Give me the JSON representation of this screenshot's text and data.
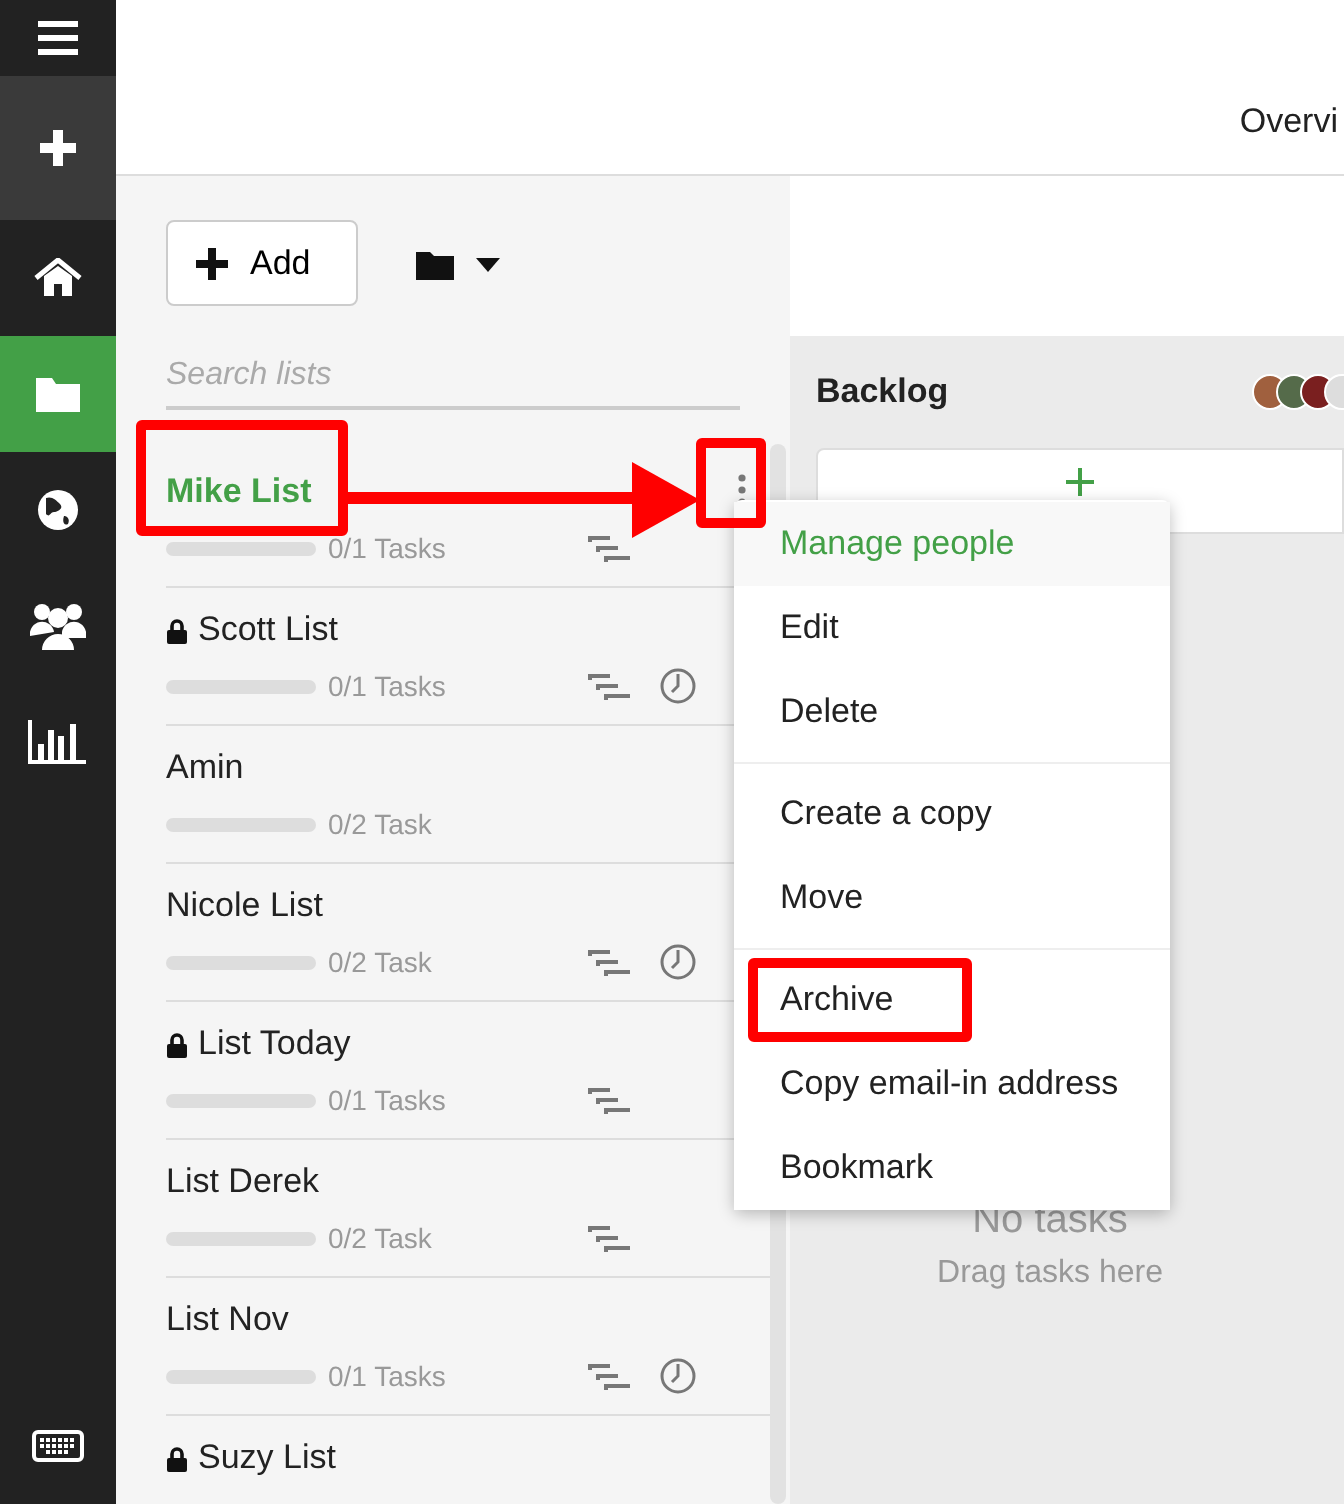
{
  "sidebar": {
    "items": [
      {
        "kind": "menu",
        "selected": false
      },
      {
        "kind": "action",
        "selected": false
      },
      {
        "kind": "home",
        "selected": false
      },
      {
        "kind": "folder",
        "selected": true
      },
      {
        "kind": "globe",
        "selected": false
      },
      {
        "kind": "people",
        "selected": false
      },
      {
        "kind": "chart",
        "selected": false
      },
      {
        "kind": "keyboard",
        "selected": false
      }
    ]
  },
  "header": {
    "tab": "Overvi"
  },
  "toolbar": {
    "add_button": "Add"
  },
  "search": {
    "placeholder": "Search lists"
  },
  "lists": [
    {
      "name": "Mike List",
      "selected": true,
      "locked": false,
      "level": 0,
      "tasks": "0/1 Tasks",
      "subtasks": true,
      "clock": false
    },
    {
      "name": "Scott List",
      "selected": false,
      "locked": true,
      "level": 0,
      "tasks": "0/1 Tasks",
      "subtasks": true,
      "clock": true
    },
    {
      "name": "Amin",
      "selected": false,
      "locked": false,
      "level": 0,
      "tasks": "0/2 Task",
      "subtasks": false,
      "clock": false
    },
    {
      "name": "Nicole List",
      "selected": false,
      "locked": false,
      "level": 0,
      "tasks": "0/2 Task",
      "subtasks": true,
      "clock": true
    },
    {
      "name": "List Today",
      "selected": false,
      "locked": true,
      "level": 0,
      "tasks": "0/1 Tasks",
      "subtasks": true,
      "clock": false
    },
    {
      "name": "List Derek",
      "selected": false,
      "locked": false,
      "level": 0,
      "tasks": "0/2 Task",
      "subtasks": true,
      "clock": false
    },
    {
      "name": "List Nov",
      "selected": false,
      "locked": false,
      "level": 0,
      "tasks": "0/1 Tasks",
      "subtasks": true,
      "clock": true
    },
    {
      "name": "Suzy List",
      "selected": false,
      "locked": true,
      "level": 0,
      "subtasks": false,
      "clock": false
    }
  ],
  "board": {
    "column_title": "Backlog",
    "empty_title": "No tasks",
    "empty_hint": "Drag tasks here"
  },
  "context_menu": {
    "groups": [
      [
        {
          "label": "Manage people",
          "selected": true
        },
        {
          "label": "Edit",
          "selected": false
        },
        {
          "label": "Delete",
          "selected": false
        }
      ],
      [
        {
          "label": "Create a copy",
          "selected": false
        },
        {
          "label": "Move",
          "selected": false
        }
      ],
      [
        {
          "label": "Archive",
          "selected": false,
          "annotated": true
        },
        {
          "label": "Copy email-in address",
          "selected": false
        },
        {
          "label": "Bookmark",
          "selected": false
        }
      ]
    ]
  }
}
